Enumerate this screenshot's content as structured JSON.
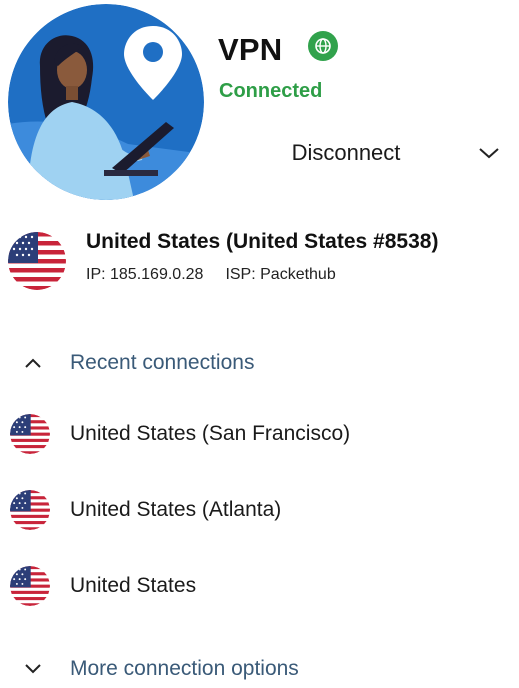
{
  "header": {
    "title": "VPN",
    "status": "Connected",
    "disconnect_label": "Disconnect",
    "badge_icon": "globe-icon",
    "dropdown_icon": "chevron-down-icon"
  },
  "current_connection": {
    "name": "United States (United States #8538)",
    "ip_text": "IP: 185.169.0.28",
    "isp_text": "ISP: Packethub",
    "flag_icon": "us-flag-icon"
  },
  "recent": {
    "label": "Recent connections",
    "expanded": true,
    "toggle_icon": "chevron-up-icon",
    "items": [
      {
        "name": "United States (San Francisco)",
        "flag_icon": "us-flag-icon"
      },
      {
        "name": "United States (Atlanta)",
        "flag_icon": "us-flag-icon"
      },
      {
        "name": "United States",
        "flag_icon": "us-flag-icon"
      }
    ]
  },
  "more": {
    "label": "More connection options",
    "expanded": false,
    "toggle_icon": "chevron-down-icon"
  },
  "colors": {
    "connected_green": "#2e9e47",
    "badge_green": "#31a24c",
    "section_blue": "#3a5a78",
    "avatar_blue": "#1f6fc4"
  }
}
